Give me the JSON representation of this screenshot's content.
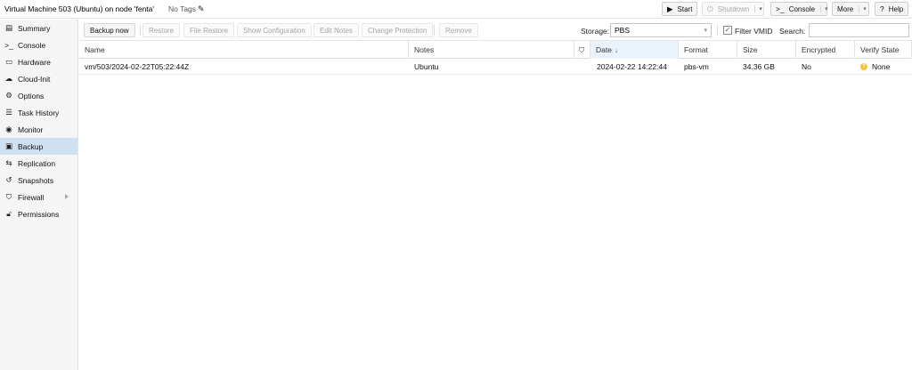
{
  "header": {
    "title": "Virtual Machine 503 (Ubuntu) on node 'fenta'",
    "tags": "No Tags",
    "buttons": {
      "start": "Start",
      "shutdown": "Shutdown",
      "console": "Console",
      "more": "More",
      "help": "Help"
    }
  },
  "sidebar": {
    "items": [
      {
        "label": "Summary",
        "icon": "summary-icon"
      },
      {
        "label": "Console",
        "icon": "console-icon"
      },
      {
        "label": "Hardware",
        "icon": "hardware-icon"
      },
      {
        "label": "Cloud-Init",
        "icon": "cloud-icon"
      },
      {
        "label": "Options",
        "icon": "gear-icon"
      },
      {
        "label": "Task History",
        "icon": "list-icon"
      },
      {
        "label": "Monitor",
        "icon": "eye-icon"
      },
      {
        "label": "Backup",
        "icon": "floppy-icon"
      },
      {
        "label": "Replication",
        "icon": "replication-icon"
      },
      {
        "label": "Snapshots",
        "icon": "history-icon"
      },
      {
        "label": "Firewall",
        "icon": "shield-icon"
      },
      {
        "label": "Permissions",
        "icon": "unlock-icon"
      }
    ],
    "active": "Backup"
  },
  "toolbar": {
    "backup_now": "Backup now",
    "restore": "Restore",
    "file_restore": "File Restore",
    "show_configuration": "Show Configuration",
    "edit_notes": "Edit Notes",
    "change_protection": "Change Protection",
    "remove": "Remove",
    "storage_label": "Storage:",
    "storage_value": "PBS",
    "filter_vmid": "Filter VMID",
    "search_label": "Search:",
    "search_value": ""
  },
  "grid": {
    "columns": {
      "name": "Name",
      "notes": "Notes",
      "date": "Date",
      "format": "Format",
      "size": "Size",
      "encrypted": "Encrypted",
      "verify_state": "Verify State"
    },
    "rows": [
      {
        "name": "vm/503/2024-02-22T05:22:44Z",
        "notes": "Ubuntu",
        "date": "2024-02-22 14:22:44",
        "format": "pbs-vm",
        "size": "34.36 GB",
        "encrypted": "No",
        "verify_state": "None"
      }
    ]
  },
  "colors": {
    "active_nav": "#cfe0f1",
    "sorted_column": "#eaf2fb",
    "verify_none": "#f3c33c"
  }
}
